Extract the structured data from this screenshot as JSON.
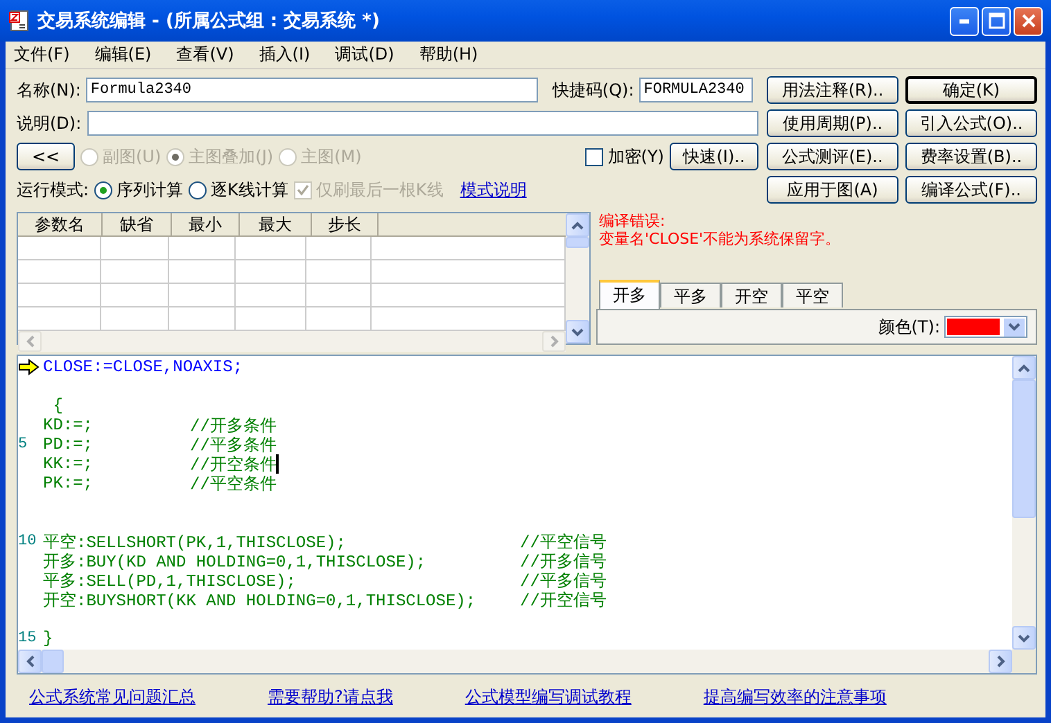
{
  "window": {
    "title": "交易系统编辑 - (所属公式组 : 交易系统 *)"
  },
  "menu": [
    {
      "label": "文件(F)"
    },
    {
      "label": "编辑(E)"
    },
    {
      "label": "查看(V)"
    },
    {
      "label": "插入(I)"
    },
    {
      "label": "调试(D)"
    },
    {
      "label": "帮助(H)"
    }
  ],
  "name_field": {
    "label": "名称(N):",
    "value": "Formula2340"
  },
  "shortcut_field": {
    "label": "快捷码(Q):",
    "value": "FORMULA2340"
  },
  "description_field": {
    "label": "说明(D):"
  },
  "collapse_button": {
    "label": "<<"
  },
  "chart_placement": [
    {
      "label": "副图(U)",
      "selected": false,
      "disabled": true
    },
    {
      "label": "主图叠加(J)",
      "selected": true,
      "disabled": true
    },
    {
      "label": "主图(M)",
      "selected": false,
      "disabled": true
    }
  ],
  "encrypt": {
    "label": "加密(Y)",
    "checked": false
  },
  "quick_button": {
    "label": "快速(I).."
  },
  "run_mode": {
    "label": "运行模式:",
    "options": [
      {
        "label": "序列计算",
        "selected": true
      },
      {
        "label": "逐K线计算",
        "selected": false
      }
    ],
    "refresh_last": {
      "label": "仅刷最后一根K线",
      "checked": true,
      "disabled": true
    },
    "link": "模式说明"
  },
  "side_buttons": [
    {
      "label": "用法注释(R)..",
      "default": false
    },
    {
      "label": "确定(K)",
      "default": true
    },
    {
      "label": "使用周期(P)..",
      "default": false
    },
    {
      "label": "引入公式(O)..",
      "default": false
    },
    {
      "label": "公式测评(E)..",
      "default": false
    },
    {
      "label": "费率设置(B)..",
      "default": false
    },
    {
      "label": "应用于图(A)",
      "default": false
    },
    {
      "label": "编译公式(F)..",
      "default": false
    }
  ],
  "params_table": {
    "columns": [
      "参数名",
      "缺省",
      "最小",
      "最大",
      "步长"
    ]
  },
  "compile_error": {
    "title": "编译错误:",
    "message": "变量名'CLOSE'不能为系统保留字。"
  },
  "signal_tabs": [
    {
      "label": "开多",
      "selected": true
    },
    {
      "label": "平多",
      "selected": false
    },
    {
      "label": "开空",
      "selected": false
    },
    {
      "label": "平空",
      "selected": false
    }
  ],
  "color_picker": {
    "label": "颜色(T):",
    "color": "#ff0000"
  },
  "editor": {
    "lines": [
      {
        "kind": "header",
        "marker": true,
        "code": "CLOSE:=CLOSE,NOAXIS;"
      },
      {
        "kind": "blank"
      },
      {
        "kind": "plain",
        "code": " {"
      },
      {
        "kind": "condition",
        "code": "KD:=;",
        "comment": "//开多条件"
      },
      {
        "kind": "condition",
        "number": "5",
        "code": "PD:=;",
        "comment": "//平多条件"
      },
      {
        "kind": "condition",
        "caret": true,
        "code": "KK:=;",
        "comment": "//开空条件"
      },
      {
        "kind": "condition",
        "code": "PK:=;",
        "comment": "//平空条件"
      },
      {
        "kind": "blank"
      },
      {
        "kind": "blank"
      },
      {
        "kind": "signal",
        "number": "10",
        "code": "平空:SELLSHORT(PK,1,THISCLOSE);",
        "comment": "//平空信号"
      },
      {
        "kind": "signal",
        "code": "开多:BUY(KD AND HOLDING=0,1,THISCLOSE);",
        "comment": "//开多信号"
      },
      {
        "kind": "signal",
        "code": "平多:SELL(PD,1,THISCLOSE);",
        "comment": "//平多信号"
      },
      {
        "kind": "signal",
        "code": "开空:BUYSHORT(KK AND HOLDING=0,1,THISCLOSE);",
        "comment": "//开空信号"
      },
      {
        "kind": "blank"
      },
      {
        "kind": "plain",
        "number": "15",
        "code": "}"
      }
    ]
  },
  "footer_links": [
    "公式系统常见问题汇总",
    "需要帮助?请点我",
    "公式模型编写调试教程",
    "提高编写效率的注意事项"
  ]
}
